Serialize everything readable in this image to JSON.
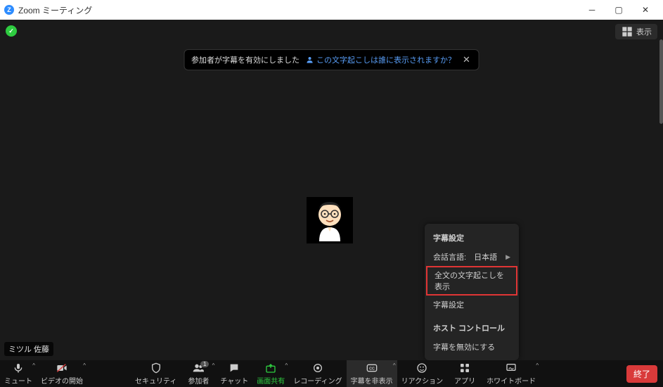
{
  "window": {
    "title": "Zoom ミーティング"
  },
  "topRight": {
    "view_label": "表示"
  },
  "toast": {
    "text": "参加者が字幕を有効にしました",
    "link_text": "この文字起こしは誰に表示されますか？"
  },
  "participant_name": "ミツル 佐藤",
  "caption_menu": {
    "section1_title": "字幕設定",
    "spoken_lang_label": "会話言語:",
    "spoken_lang_value": "日本語",
    "show_full_transcript": "全文の文字起こしを表示",
    "subtitle_settings": "字幕設定",
    "section2_title": "ホスト コントロール",
    "disable_subtitles": "字幕を無効にする"
  },
  "controls": {
    "mute": "ミュート",
    "video": "ビデオの開始",
    "security": "セキュリティ",
    "participants": "参加者",
    "participants_count": "1",
    "chat": "チャット",
    "share": "画面共有",
    "record": "レコーディング",
    "captions": "字幕を非表示",
    "reactions": "リアクション",
    "apps": "アプリ",
    "whiteboard": "ホワイトボード",
    "end": "終了"
  }
}
